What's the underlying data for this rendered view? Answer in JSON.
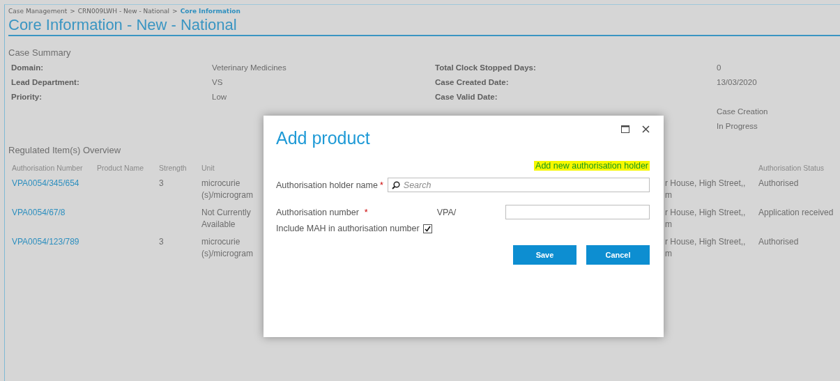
{
  "breadcrumb": [
    {
      "label": "Case Management",
      "current": false
    },
    {
      "label": "CRN009LWH - New - National",
      "current": false
    },
    {
      "label": "Core Information",
      "current": true
    }
  ],
  "breadcrumb_separator": ">",
  "title": "Core Information - New - National",
  "case_summary": {
    "title": "Case Summary",
    "left": [
      {
        "label": "Domain:",
        "value": "Veterinary Medicines"
      },
      {
        "label": "Lead Department:",
        "value": "VS"
      },
      {
        "label": "Priority:",
        "value": "Low"
      }
    ],
    "right": [
      {
        "label": "Total Clock Stopped Days:",
        "value": "0"
      },
      {
        "label": "Case Created Date:",
        "value": "13/03/2020"
      },
      {
        "label": "Case Valid Date:"
      },
      {
        "value": "Case Creation"
      },
      {
        "value": "In Progress"
      }
    ]
  },
  "regulated_items": {
    "title": "Regulated Item(s) Overview",
    "columns": {
      "authorisation_number": "Authorisation Number",
      "product_name": "Product Name",
      "strength": "Strength",
      "unit": "Unit",
      "authorisation_status": "Authorisation Status"
    },
    "rows": [
      {
        "authorisation_number": "VPA0054/345/654",
        "strength": "3",
        "unit": "microcurie (s)/microgram",
        "column_5": [
          "r House, High Street,,",
          "m"
        ],
        "authorisation_status": "Authorised"
      },
      {
        "authorisation_number": "VPA0054/67/8",
        "unit": "Not Currently Available",
        "column_5": [
          "r House, High Street,,",
          "m"
        ],
        "authorisation_status": "Application received"
      },
      {
        "authorisation_number": "VPA0054/123/789",
        "strength": "3",
        "unit": "microcurie (s)/microgram",
        "column_5": [
          "r House, High Street,,",
          "m"
        ],
        "authorisation_status": "Authorised"
      }
    ]
  },
  "dialog": {
    "title": "Add product",
    "link": "Add new authorisation holder",
    "holder_field": {
      "label": "Authorisation holder name",
      "required": true,
      "placeholder": "Search"
    },
    "number_field": {
      "label": "Authorisation number",
      "required": true,
      "prefix": "VPA/"
    },
    "include_mah": {
      "label": "Include MAH in authorisation number",
      "checked": true
    },
    "buttons": [
      "Save",
      "Cancel"
    ],
    "required_mark": "*"
  }
}
